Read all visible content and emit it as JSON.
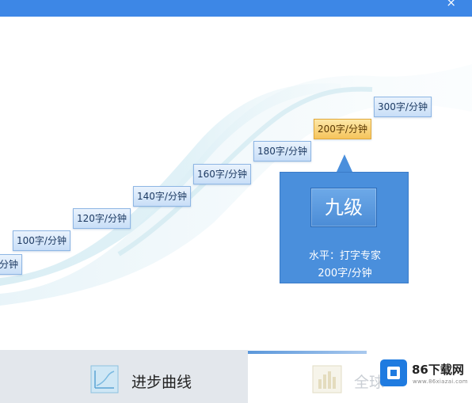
{
  "window": {
    "close_label": "×"
  },
  "steps": [
    {
      "label": "分钟",
      "active": false
    },
    {
      "label": "100字/分钟",
      "active": false
    },
    {
      "label": "120字/分钟",
      "active": false
    },
    {
      "label": "140字/分钟",
      "active": false
    },
    {
      "label": "160字/分钟",
      "active": false
    },
    {
      "label": "180字/分钟",
      "active": false
    },
    {
      "label": "200字/分钟",
      "active": true
    },
    {
      "label": "300字/分钟",
      "active": false
    }
  ],
  "level_card": {
    "level": "九级",
    "level_line": "水平：打字专家",
    "speed_line": "200字/分钟"
  },
  "tabs": {
    "progress_label": "进步曲线",
    "global_label": "全球"
  },
  "watermark": {
    "brand": "86下载网",
    "url": "www.86xiazai.com"
  },
  "colors": {
    "titlebar": "#3d87e6",
    "step_active": "#f5c45c",
    "callout": "#4a8fdc"
  }
}
